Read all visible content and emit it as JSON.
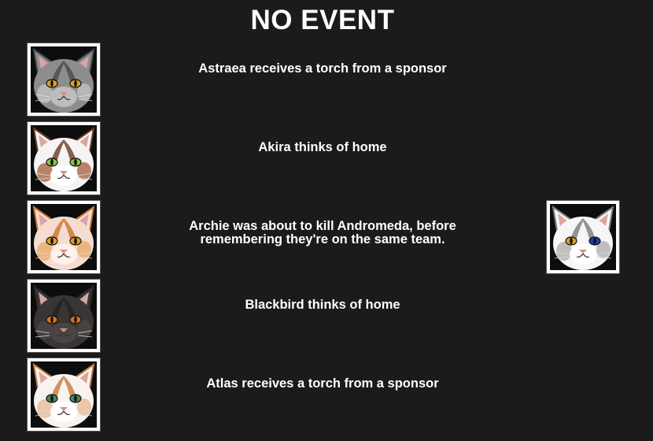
{
  "title": "NO EVENT",
  "events": [
    {
      "text": "Astraea receives a torch from a sponsor",
      "portrait": {
        "name": "astraea-portrait",
        "fur": "#8d8d8d",
        "dark": "#4a4a4a",
        "light": "#c9c9c9",
        "eyes": [
          "#e0a020",
          "#e0a020"
        ],
        "muzzle": "#bdbdbd"
      }
    },
    {
      "text": "Akira thinks of home",
      "portrait": {
        "name": "akira-portrait",
        "fur": "#f4f4f4",
        "dark": "#6b3a1f",
        "light": "#a0522d",
        "eyes": [
          "#8bc34a",
          "#8bc34a"
        ],
        "muzzle": "#ffffff"
      }
    },
    {
      "text": "Archie was about to kill Andromeda, before\nremembering they're on the same team.",
      "portrait": {
        "name": "archie-portrait",
        "fur": "#f6dcd0",
        "dark": "#c8742e",
        "light": "#e8a45a",
        "eyes": [
          "#e0a020",
          "#e0a020"
        ],
        "muzzle": "#fff0ea"
      },
      "partner": {
        "name": "andromeda-portrait",
        "fur": "#f6f6f6",
        "dark": "#7a7a7a",
        "light": "#a8a8a8",
        "eyes": [
          "#e0a020",
          "#1a3fb8"
        ],
        "muzzle": "#ffffff"
      }
    },
    {
      "text": "Blackbird thinks of home",
      "portrait": {
        "name": "blackbird-portrait",
        "fur": "#3a3535",
        "dark": "#222020",
        "light": "#4d4747",
        "eyes": [
          "#d9731a",
          "#d9731a"
        ],
        "muzzle": "#4a4444"
      }
    },
    {
      "text": "Atlas receives a torch from a sponsor",
      "portrait": {
        "name": "atlas-portrait",
        "fur": "#f8f3ef",
        "dark": "#c67a3c",
        "light": "#e8b48c",
        "eyes": [
          "#4a8a5a",
          "#4a8a5a"
        ],
        "muzzle": "#ffffff"
      }
    }
  ]
}
